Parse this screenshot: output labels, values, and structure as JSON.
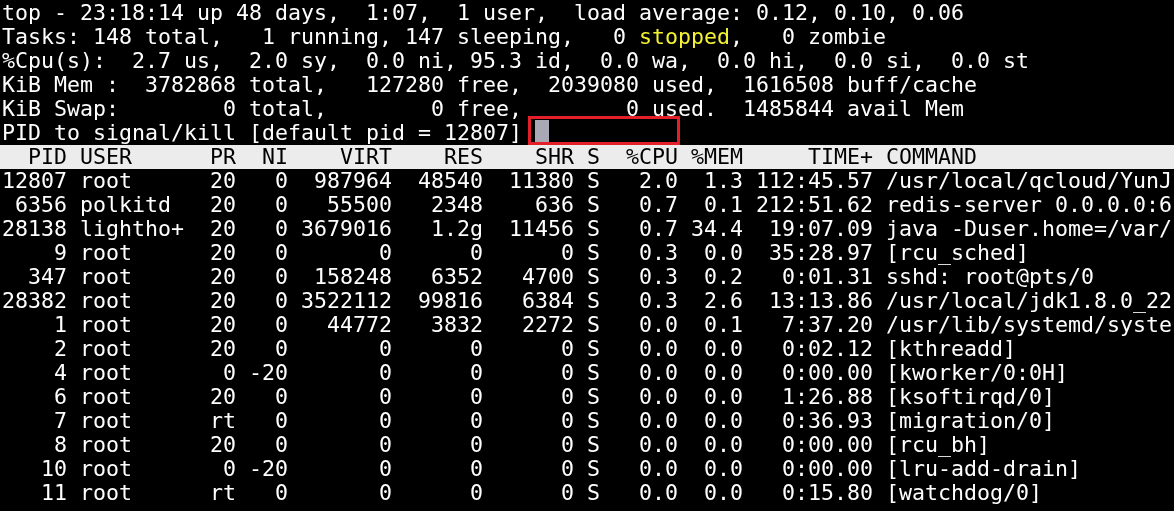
{
  "summary": [
    [
      {
        "text": "top - 23:18:14 up 48 days,  1:07,  1 user,  load average: 0.12, 0.10, 0.06",
        "highlight": false
      }
    ],
    [
      {
        "text": "Tasks: 148 total,   1 running, 147 sleeping,   0 ",
        "highlight": false
      },
      {
        "text": "stopped",
        "highlight": true
      },
      {
        "text": ",   0 zombie",
        "highlight": false
      }
    ],
    [
      {
        "text": "%Cpu(s):  2.7 us,  2.0 sy,  0.0 ni, 95.3 id,  0.0 wa,  0.0 hi,  0.0 si,  0.0 st",
        "highlight": false
      }
    ],
    [
      {
        "text": "KiB Mem :  3782868 total,   127280 free,  2039080 used,  1616508 buff/cache",
        "highlight": false
      }
    ],
    [
      {
        "text": "KiB Swap:        0 total,        0 free,        0 used.  1485844 avail Mem",
        "highlight": false
      }
    ]
  ],
  "prompt": {
    "text": "PID to signal/kill [default pid = 12807]",
    "highlighted": true
  },
  "table": {
    "columns": [
      "PID",
      "USER",
      "PR",
      "NI",
      "VIRT",
      "RES",
      "SHR",
      "S",
      "%CPU",
      "%MEM",
      "TIME+",
      "COMMAND"
    ],
    "rows": [
      [
        "12807",
        "root",
        "20",
        "0",
        "987964",
        "48540",
        "11380",
        "S",
        "2.0",
        "1.3",
        "112:45.57",
        "/usr/local/qcloud/YunJ"
      ],
      [
        "6356",
        "polkitd",
        "20",
        "0",
        "55500",
        "2348",
        "636",
        "S",
        "0.7",
        "0.1",
        "212:51.62",
        "redis-server 0.0.0.0:6"
      ],
      [
        "28138",
        "lightho+",
        "20",
        "0",
        "3679016",
        "1.2g",
        "11456",
        "S",
        "0.7",
        "34.4",
        "19:07.09",
        "java -Duser.home=/var/"
      ],
      [
        "9",
        "root",
        "20",
        "0",
        "0",
        "0",
        "0",
        "S",
        "0.3",
        "0.0",
        "35:28.97",
        "[rcu_sched]"
      ],
      [
        "347",
        "root",
        "20",
        "0",
        "158248",
        "6352",
        "4700",
        "S",
        "0.3",
        "0.2",
        "0:01.31",
        "sshd: root@pts/0"
      ],
      [
        "28382",
        "root",
        "20",
        "0",
        "3522112",
        "99816",
        "6384",
        "S",
        "0.3",
        "2.6",
        "13:13.86",
        "/usr/local/jdk1.8.0_22"
      ],
      [
        "1",
        "root",
        "20",
        "0",
        "44772",
        "3832",
        "2272",
        "S",
        "0.0",
        "0.1",
        "7:37.20",
        "/usr/lib/systemd/syste"
      ],
      [
        "2",
        "root",
        "20",
        "0",
        "0",
        "0",
        "0",
        "S",
        "0.0",
        "0.0",
        "0:02.12",
        "[kthreadd]"
      ],
      [
        "4",
        "root",
        "0",
        "-20",
        "0",
        "0",
        "0",
        "S",
        "0.0",
        "0.0",
        "0:00.00",
        "[kworker/0:0H]"
      ],
      [
        "6",
        "root",
        "20",
        "0",
        "0",
        "0",
        "0",
        "S",
        "0.0",
        "0.0",
        "1:26.88",
        "[ksoftirqd/0]"
      ],
      [
        "7",
        "root",
        "rt",
        "0",
        "0",
        "0",
        "0",
        "S",
        "0.0",
        "0.0",
        "0:36.93",
        "[migration/0]"
      ],
      [
        "8",
        "root",
        "20",
        "0",
        "0",
        "0",
        "0",
        "S",
        "0.0",
        "0.0",
        "0:00.00",
        "[rcu_bh]"
      ],
      [
        "10",
        "root",
        "0",
        "-20",
        "0",
        "0",
        "0",
        "S",
        "0.0",
        "0.0",
        "0:00.00",
        "[lru-add-drain]"
      ],
      [
        "11",
        "root",
        "rt",
        "0",
        "0",
        "0",
        "0",
        "S",
        "0.0",
        "0.0",
        "0:15.80",
        "[watchdog/0]"
      ]
    ]
  }
}
